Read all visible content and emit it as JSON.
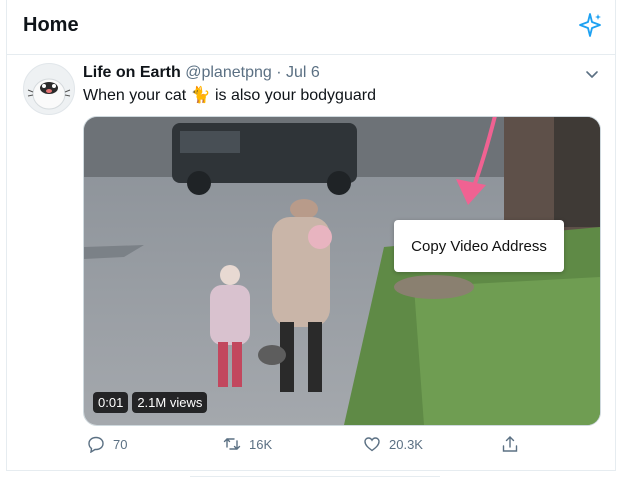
{
  "header": {
    "title": "Home",
    "sparkle_icon": "sparkle-icon"
  },
  "tweet": {
    "display_name": "Life on Earth",
    "handle": "@planetpng",
    "separator": "·",
    "date": "Jul 6",
    "text_before": "When your cat ",
    "emoji": "🐈",
    "text_after": " is also your bodyguard",
    "media": {
      "context_menu_item": "Copy Video Address",
      "time": "0:01",
      "views": "2.1M views"
    },
    "actions": {
      "reply_count": "70",
      "retweet_count": "16K",
      "like_count": "20.3K"
    }
  },
  "colors": {
    "accent": "#1da1f2",
    "secondary_text": "#5b7083",
    "annotation_arrow": "#f06292"
  }
}
